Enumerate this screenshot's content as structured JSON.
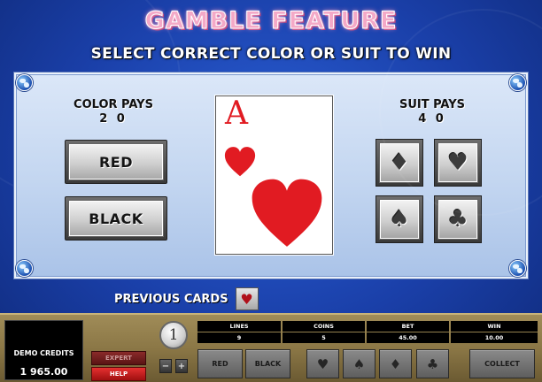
{
  "header": {
    "title": "GAMBLE FEATURE",
    "subtitle": "SELECT CORRECT COLOR OR SUIT TO WIN"
  },
  "color_section": {
    "label": "COLOR PAYS",
    "value": "2 0",
    "buttons": {
      "red": "RED",
      "black": "BLACK"
    }
  },
  "suit_section": {
    "label": "SUIT PAYS",
    "value": "4 0",
    "buttons": {
      "diamond": "♦",
      "heart": "♥",
      "spade": "♠",
      "club": "♣"
    }
  },
  "card": {
    "rank": "A",
    "suit": "heart-icon",
    "color": "#e11b22"
  },
  "previous_cards": {
    "label": "PREVIOUS CARDS",
    "cards": [
      "♥"
    ]
  },
  "bottom_bar": {
    "credits_label": "DEMO CREDITS",
    "credits_value": "1 965.00",
    "expert_label": "EXPERT",
    "help_label": "HELP",
    "coin_value": "1",
    "minus_label": "−",
    "plus_label": "+",
    "stats": {
      "lines_label": "LINES",
      "lines_value": "9",
      "coins_label": "COINS",
      "coins_value": "5",
      "bet_label": "BET",
      "bet_value": "45.00",
      "win_label": "WIN",
      "win_value": "10.00"
    },
    "controls": {
      "red": "RED",
      "black": "BLACK",
      "heart": "♥",
      "spade": "♠",
      "diamond": "♦",
      "club": "♣",
      "collect": "COLLECT"
    }
  },
  "colors": {
    "background": "#1a3fa8",
    "title_pink": "#f4a9c7",
    "card_red": "#e11b22",
    "help_red": "#e63030",
    "bar_gold": "#a08c58"
  }
}
